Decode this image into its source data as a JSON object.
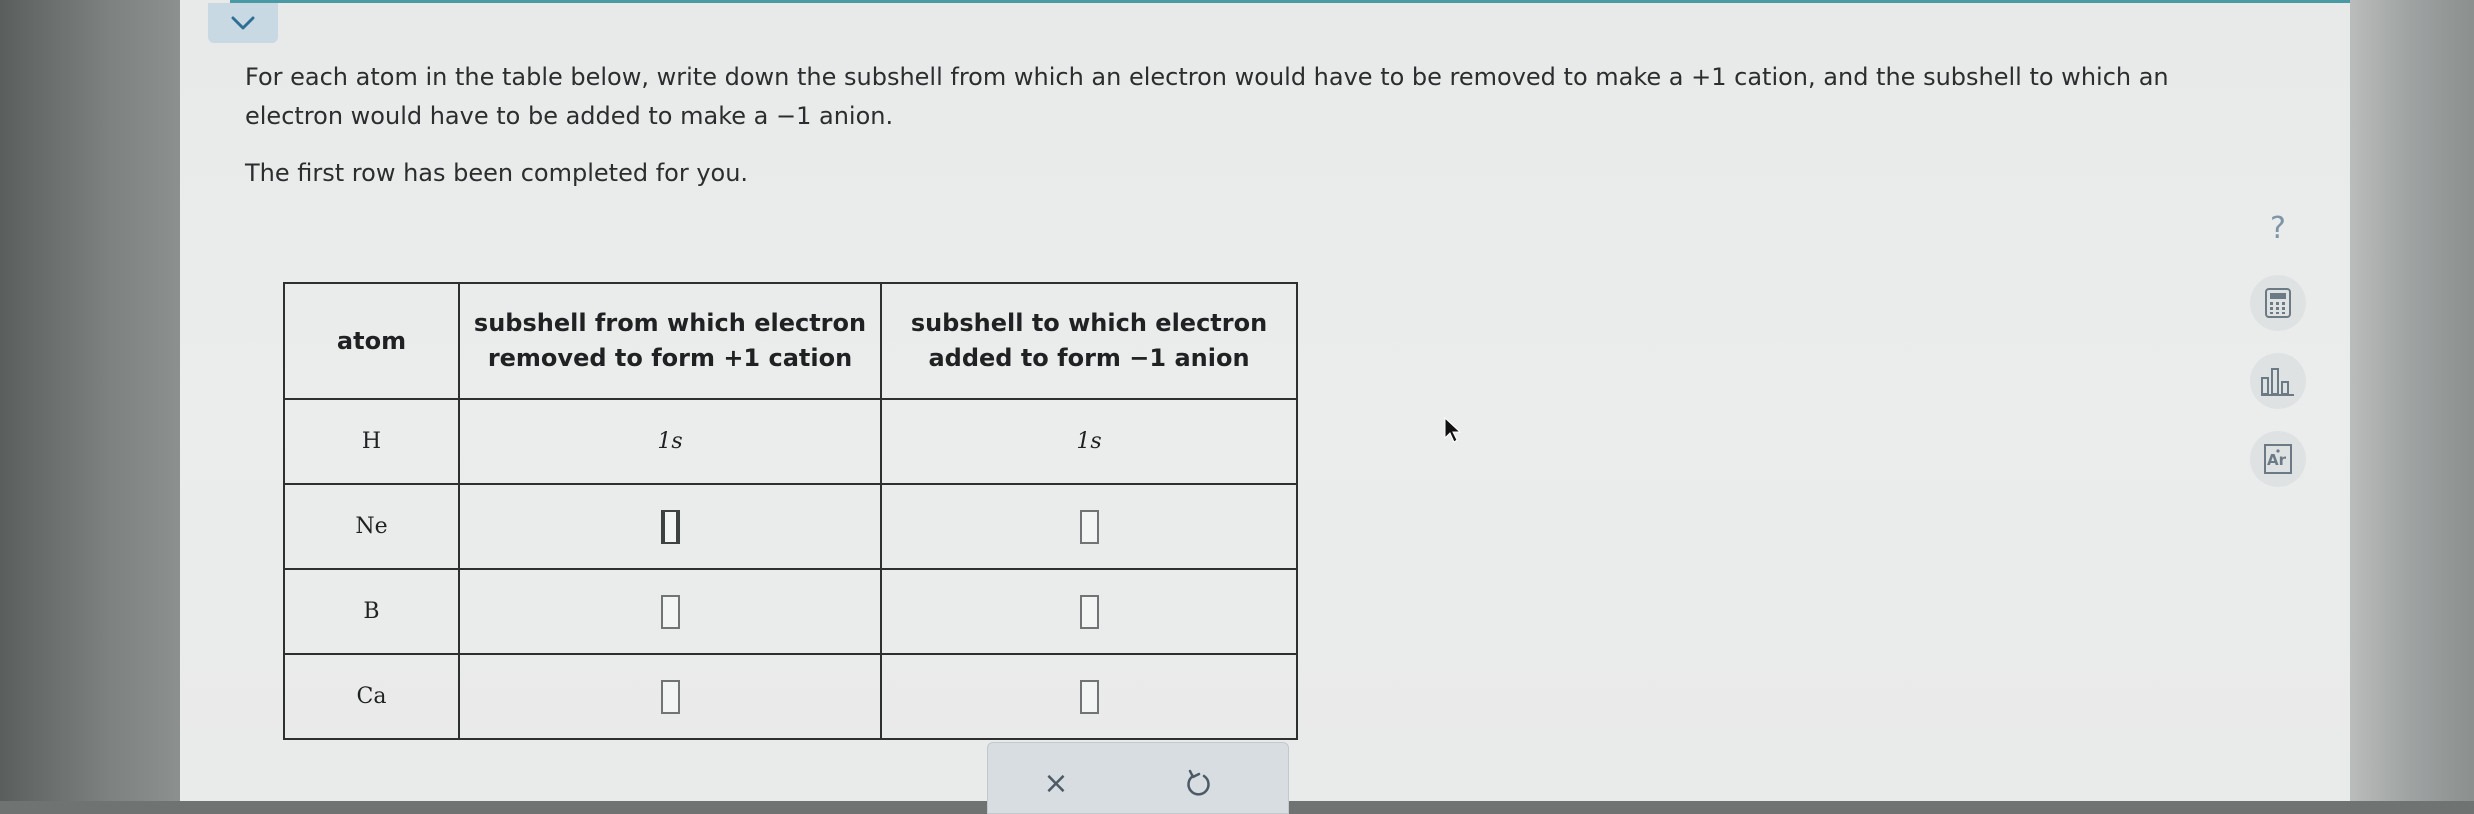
{
  "prompt": {
    "line1": "For each atom in the table below, write down the subshell from which an electron would have to be removed to make a +1 cation, and the subshell to which an",
    "line2": "electron would have to be added to make a −1 anion.",
    "line3": "The first row has been completed for you."
  },
  "table": {
    "headers": {
      "atom": "atom",
      "removed_line1": "subshell from which electron",
      "removed_line2": "removed to form +1 cation",
      "added_line1": "subshell to which electron",
      "added_line2": "added to form −1 anion"
    },
    "rows": [
      {
        "atom": "H",
        "removed": "1s",
        "added": "1s"
      },
      {
        "atom": "Ne",
        "removed": "",
        "added": ""
      },
      {
        "atom": "B",
        "removed": "",
        "added": ""
      },
      {
        "atom": "Ca",
        "removed": "",
        "added": ""
      }
    ]
  },
  "toolbar": {
    "clear_symbol": "×",
    "undo_symbol": "↺"
  },
  "side_tools": {
    "help_symbol": "?",
    "icons": [
      "calculator-icon",
      "chart-icon",
      "periodic-table-icon"
    ],
    "periodic_label": "Ar"
  },
  "icons": {
    "collapse": "chevron-down-icon"
  }
}
